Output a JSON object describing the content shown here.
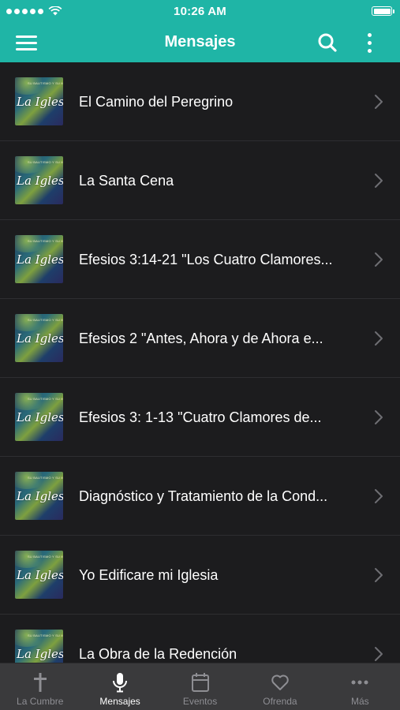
{
  "status": {
    "time": "10:26 AM"
  },
  "header": {
    "title": "Mensajes"
  },
  "thumbnail": {
    "text": "La Iglesia",
    "subtext": "SU BAUTISMO Y SU MISIÓN"
  },
  "messages": [
    {
      "title": "El Camino del Peregrino"
    },
    {
      "title": "La Santa Cena"
    },
    {
      "title": "Efesios 3:14-21 \"Los Cuatro Clamores..."
    },
    {
      "title": "Efesios 2   \"Antes, Ahora y de Ahora e..."
    },
    {
      "title": "Efesios 3: 1-13  \"Cuatro Clamores de..."
    },
    {
      "title": "Diagnóstico y Tratamiento de la Cond..."
    },
    {
      "title": "Yo Edificare mi Iglesia"
    },
    {
      "title": "La Obra de la Redención"
    }
  ],
  "tabs": [
    {
      "label": "La Cumbre",
      "icon": "cross-icon"
    },
    {
      "label": "Mensajes",
      "icon": "microphone-icon",
      "active": true
    },
    {
      "label": "Eventos",
      "icon": "calendar-icon"
    },
    {
      "label": "Ofrenda",
      "icon": "heart-icon"
    },
    {
      "label": "Más",
      "icon": "more-dots-icon"
    }
  ],
  "colors": {
    "accent": "#1fb5a6",
    "background": "#1c1c1e",
    "tabbar": "#3a3a3c"
  }
}
